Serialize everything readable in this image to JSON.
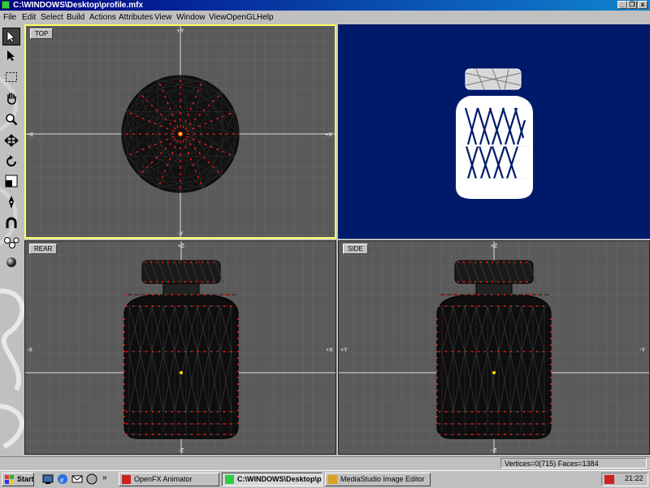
{
  "window": {
    "title": "C:\\WINDOWS\\Desktop\\profile.mfx"
  },
  "menu": [
    "File",
    "Edit",
    "Select",
    "Build",
    "Actions",
    "Attributes",
    "View",
    "Window",
    "ViewOpenGL",
    "Help"
  ],
  "viewports": {
    "top": {
      "label": "TOP",
      "axes": {
        "top": "+Y",
        "bottom": "-Y",
        "left": "-X",
        "right": "+X"
      }
    },
    "rear": {
      "label": "REAR",
      "axes": {
        "top": "+Z",
        "bottom": "-Z",
        "left": "-X",
        "right": "+X"
      }
    },
    "side": {
      "label": "SIDE",
      "axes": {
        "top": "+Z",
        "bottom": "-Z",
        "left": "+Y",
        "right": "-Y"
      }
    }
  },
  "statusbar": {
    "text": "Vertices=0(715) Faces=1384"
  },
  "taskbar": {
    "start": "Start",
    "quicklaunch_more": "»",
    "buttons": [
      {
        "label": "OpenFX Animator",
        "icon": "openfx-icon"
      },
      {
        "label": "C:\\WINDOWS\\Desktop\\p...",
        "icon": "designer-icon",
        "active": true
      },
      {
        "label": "MediaStudio Image Editor",
        "icon": "mediastudio-icon"
      }
    ],
    "clock": "21:22"
  },
  "colors": {
    "grid_bg": "#5a5a5a",
    "gl_bg": "#001a6a",
    "vertex": "#ff2020",
    "active_border": "#ffff66",
    "titlebar": "#000080"
  }
}
